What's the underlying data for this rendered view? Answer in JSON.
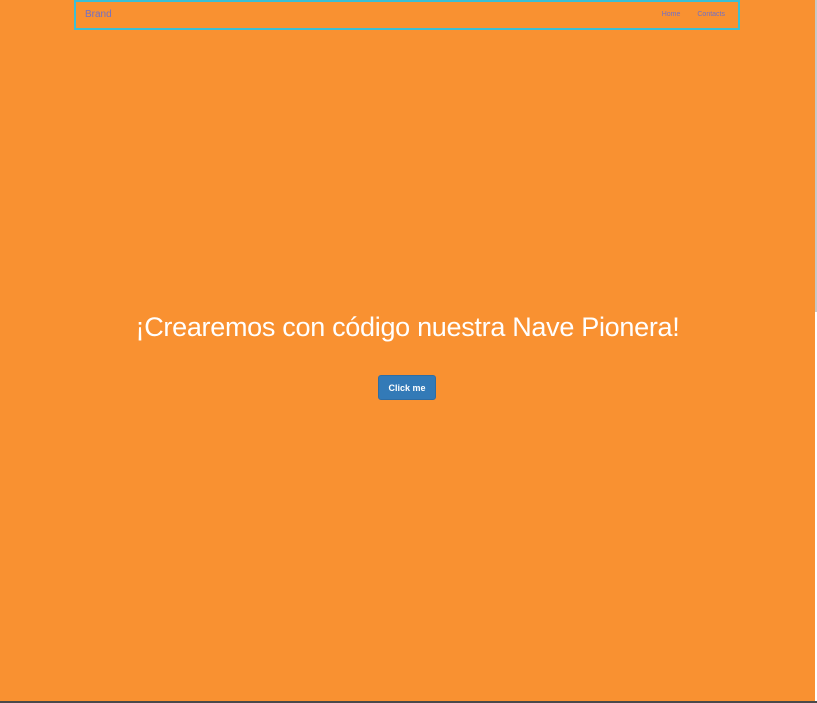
{
  "navbar": {
    "brand": "Brand",
    "links": [
      {
        "label": "Home"
      },
      {
        "label": "Contacts"
      }
    ]
  },
  "hero": {
    "title": "¡Crearemos con código nuestra Nave Pionera!",
    "button_label": "Click me"
  },
  "colors": {
    "background": "#f99131",
    "navbar_border": "#3bbfd6",
    "link": "#6f70c9",
    "button": "#337ab7",
    "title": "#ffffff"
  }
}
